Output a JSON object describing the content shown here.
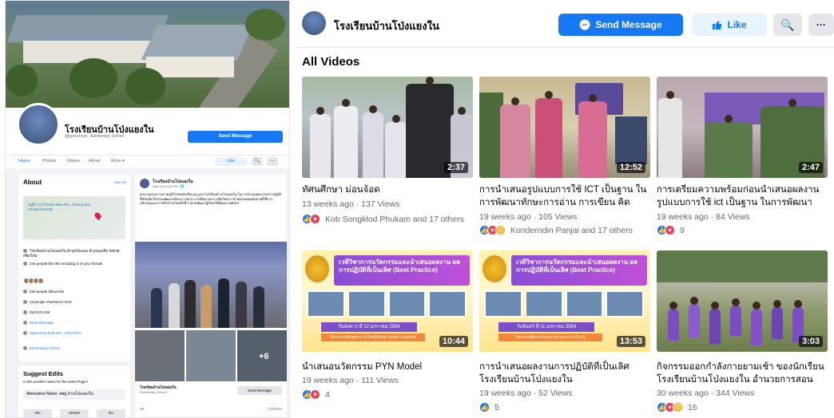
{
  "left": {
    "page_name": "โรงเรียนบ้านโป่งแยงใน",
    "handle": "@pynschool · Elementary School",
    "send_message": "Send Message",
    "tabs": [
      "Home",
      "Photos",
      "Videos",
      "About",
      "More ▾"
    ],
    "like": "Like",
    "search_glyph": "🔍",
    "more_glyph": "···",
    "about": {
      "title": "About",
      "see_all": "See All",
      "map_address": "หมู่ที่ 1 ต.โป่งแยง Mae Rim, Chiang Mai, Thailand 50180",
      "items": [
        {
          "text": "โรงเรียนบ้านโป่งแยงใน ตำบลโป่งแยง อำเภอแม่ริม จังหวัดเชียงใหม่",
          "blue": false
        },
        {
          "text": "240 people like this including 3 of your friends",
          "blue": false
        },
        {
          "text": "250 people follow this",
          "blue": false
        },
        {
          "text": "13 people checked in here",
          "blue": false
        },
        {
          "text": "053 879 229",
          "blue": false
        },
        {
          "text": "Send Message",
          "blue": true
        },
        {
          "text": "Open Now 8:00 AM – 4:00 PM ▾",
          "blue": true
        },
        {
          "text": "Elementary School",
          "blue": true
        }
      ]
    },
    "suggest": {
      "title": "Suggest Edits",
      "question": "Is this another name for the same Page?",
      "alt_name": "Alternative Name: สพฐ.บ้านโป่งแยงใน",
      "buttons": [
        "Yes",
        "Unsure",
        "No"
      ]
    },
    "post": {
      "name": "โรงเรียนบ้านโป่งแยงใน",
      "date": "May 4 at 2:46 PM · 🌐",
      "text": "ผลงานและความภาคภูมิใจของนักเรียน ครู และโรงเรียนบ้านโป่งแยงใน ในการนำเสนอผลงานการปฏิบัติที่เป็นเลิศ กิจกรรมพัฒนาทักษะการอ่าน การเขียน และการคิดวิเคราะห์ ขอขอบคุณทุกท่านที่ให้การสนับสนุนและร่วมกิจกรรมในครั้งนี้ ร่วมกันพัฒนาผู้เรียนให้มีคุณภาพต่อไป",
      "footer_name": "โรงเรียนบ้านโป่งแยงใน",
      "footer_sub": "Elementary School",
      "send": "Send Message",
      "plus_more": "+6",
      "reactions": "48",
      "shares": "3 Shares"
    }
  },
  "right": {
    "page_name": "โรงเรียนบ้านโป่งแยงใน",
    "send_message": "Send Message",
    "like": "Like",
    "search_glyph": "🔍",
    "more_glyph": "···",
    "section_title": "All Videos",
    "videos": [
      {
        "title": "ทัศนศึกษา ม่อนจ้อด",
        "meta": "13 weeks ago · 137 Views",
        "duration": "2:37",
        "reactions": [
          "like",
          "love"
        ],
        "reaction_text": "Kob Songklod Phukam and 17 others",
        "thumb": "students"
      },
      {
        "title": "การนำเสนอรูปแบบการใช้ ICT เป็นฐาน ในการพัฒนาทักษะการอ่าน การเขียน คิดวิเคราะห์...",
        "meta": "19 weeks ago · 105 Views",
        "duration": "12:52",
        "reactions": [
          "like",
          "love",
          "wow"
        ],
        "reaction_text": "Konderndin Panjai and 17 others",
        "thumb": "teachers"
      },
      {
        "title": "การเตรียมความพร้อมก่อนนำเสนอผลงาน รูปแบบการใช้ ict เป็นฐาน ในการพัฒนาทักษะ...",
        "meta": "19 weeks ago · 84 Views",
        "duration": "2:47",
        "reactions": [
          "like",
          "love"
        ],
        "reaction_text": "9",
        "thumb": "prep"
      },
      {
        "title": "นำเสนอนวัตกรรม PYN Model",
        "meta": "19 weeks ago · 111 Views",
        "duration": "10:44",
        "reactions": [
          "like",
          "love"
        ],
        "reaction_text": "4",
        "thumb": "banner",
        "banner_title": "เวทีวิชาการนวัตกรรมและนำเสนอผลงาน ผลการปฏิบัติที่เป็นเลิศ (Best Practice)",
        "banner_date": "วันอังคาร ที่ 12 มกราคม 2564",
        "banner_sub": "กิจกรรมหลักสูตรการเรียนรู้เชิงรุก Active Learning"
      },
      {
        "title": "การนำเสนอผลงานการปฏิบัติที่เป็นเลิศ โรงเรียนบ้านโป่งแยงใน",
        "meta": "19 weeks ago · 52 Views",
        "duration": "13:53",
        "reactions": [
          "like"
        ],
        "reaction_text": "5",
        "thumb": "banner",
        "banner_title": "เวทีวิชาการนวัตกรรมและนำเสนอผลงาน ผลการปฏิบัติที่เป็นเลิศ (Best Practice)",
        "banner_date": "วันจันทร์ ที่ 11 มกราคม 2564",
        "banner_sub": "กิจกรรมพัฒนาทักษะภาษาและการเรียนรู้"
      },
      {
        "title": "กิจกรรมออกกำลังกายยามเช้า ของนักเรียนโรงเรียนบ้านโป่งแยงใน อำนวยการสอนโดย...",
        "meta": "30 weeks ago · 344 Views",
        "duration": "3:03",
        "reactions": [
          "like",
          "love",
          "wow"
        ],
        "reaction_text": "16",
        "thumb": "exercise"
      }
    ]
  },
  "colors": {
    "accent": "#1877f2",
    "bg": "#f0f2f5",
    "muted": "#65676b"
  }
}
